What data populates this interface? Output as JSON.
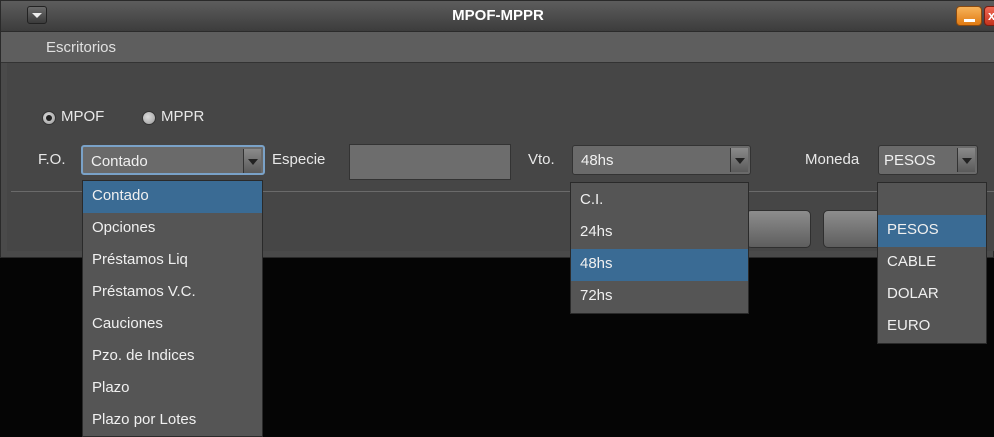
{
  "window": {
    "title": "MPOF-MPPR"
  },
  "menu": {
    "items": [
      "Escritorios"
    ]
  },
  "radios": [
    {
      "label": "MPOF",
      "checked": true
    },
    {
      "label": "MPPR",
      "checked": false
    }
  ],
  "fo": {
    "label": "F.O.",
    "value": "Contado"
  },
  "especie": {
    "label": "Especie",
    "value": ""
  },
  "vto": {
    "label": "Vto.",
    "value": "48hs"
  },
  "moneda": {
    "label": "Moneda",
    "value": "PESOS"
  },
  "fo_options": [
    "Contado",
    "Opciones",
    "Préstamos Liq",
    "Préstamos V.C.",
    "Cauciones",
    "Pzo. de Indices",
    "Plazo",
    "Plazo por Lotes"
  ],
  "vto_options": [
    "C.I.",
    "24hs",
    "48hs",
    "72hs"
  ],
  "moneda_options": [
    "",
    "PESOS",
    "CABLE",
    "DOLAR",
    "EURO"
  ]
}
